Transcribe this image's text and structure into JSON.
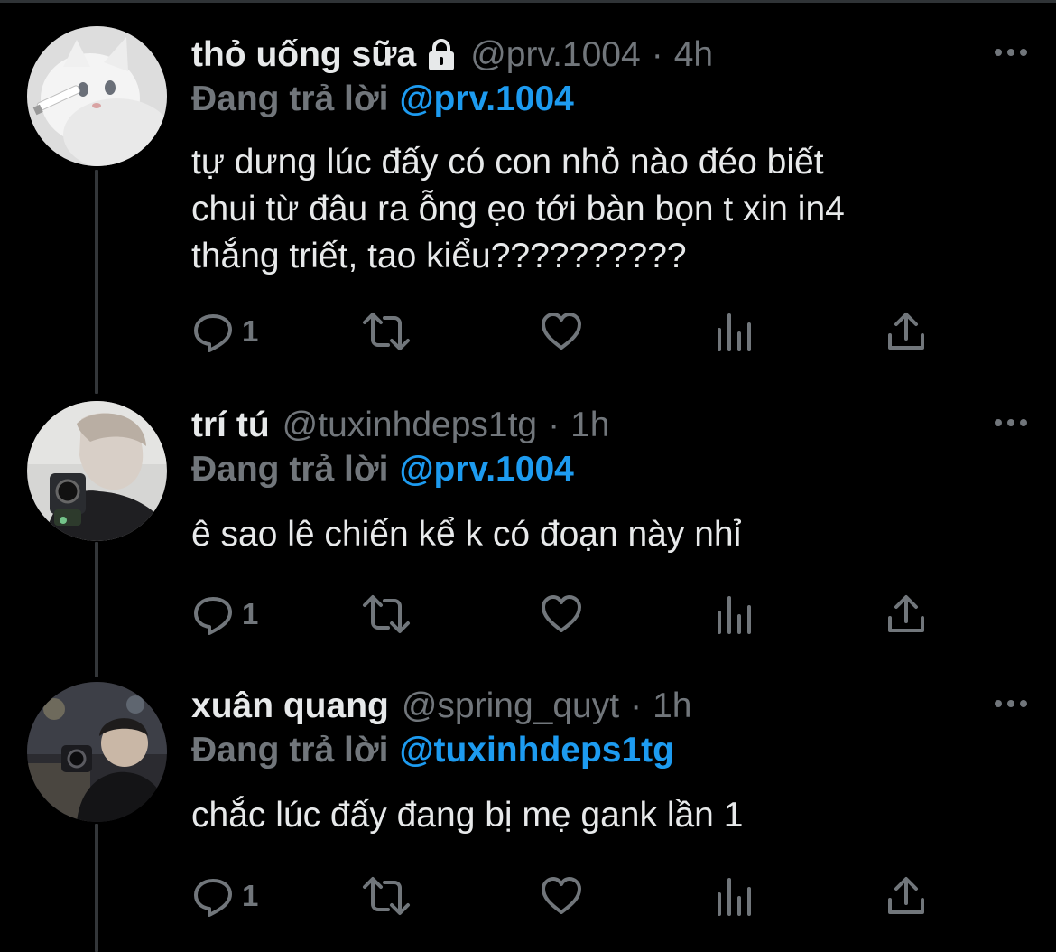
{
  "tweets": [
    {
      "display_name": "thỏ uống sữa",
      "protected": true,
      "handle": "@prv.1004",
      "time": "4h",
      "reply_prefix": "Đang trả lời",
      "reply_target": "@prv.1004",
      "body_lines": [
        "tự dưng lúc đấy có con nhỏ nào đéo biết",
        "chui từ đâu ra ỗng ẹo tới bàn bọn t xin in4",
        "thắng triết, tao kiểu??????????"
      ],
      "reply_count": "1"
    },
    {
      "display_name": "trí tú",
      "protected": false,
      "handle": "@tuxinhdeps1tg",
      "time": "1h",
      "reply_prefix": "Đang trả lời",
      "reply_target": "@prv.1004",
      "body_lines": [
        "ê sao lê chiến kể k có đoạn này nhỉ"
      ],
      "reply_count": "1"
    },
    {
      "display_name": "xuân quang",
      "protected": false,
      "handle": "@spring_quyt",
      "time": "1h",
      "reply_prefix": "Đang trả lời",
      "reply_target": "@tuxinhdeps1tg",
      "body_lines": [
        "chắc lúc đấy đang bị mẹ gank lần 1"
      ],
      "reply_count": "1"
    }
  ],
  "separator": "·",
  "colors": {
    "background": "#000000",
    "text": "#e7e9ea",
    "muted": "#71767b",
    "accent": "#1d9bf0",
    "thread_line": "#333639"
  },
  "icons": [
    "lock-icon",
    "more-icon",
    "reply-icon",
    "retweet-icon",
    "like-icon",
    "views-icon",
    "share-icon"
  ]
}
